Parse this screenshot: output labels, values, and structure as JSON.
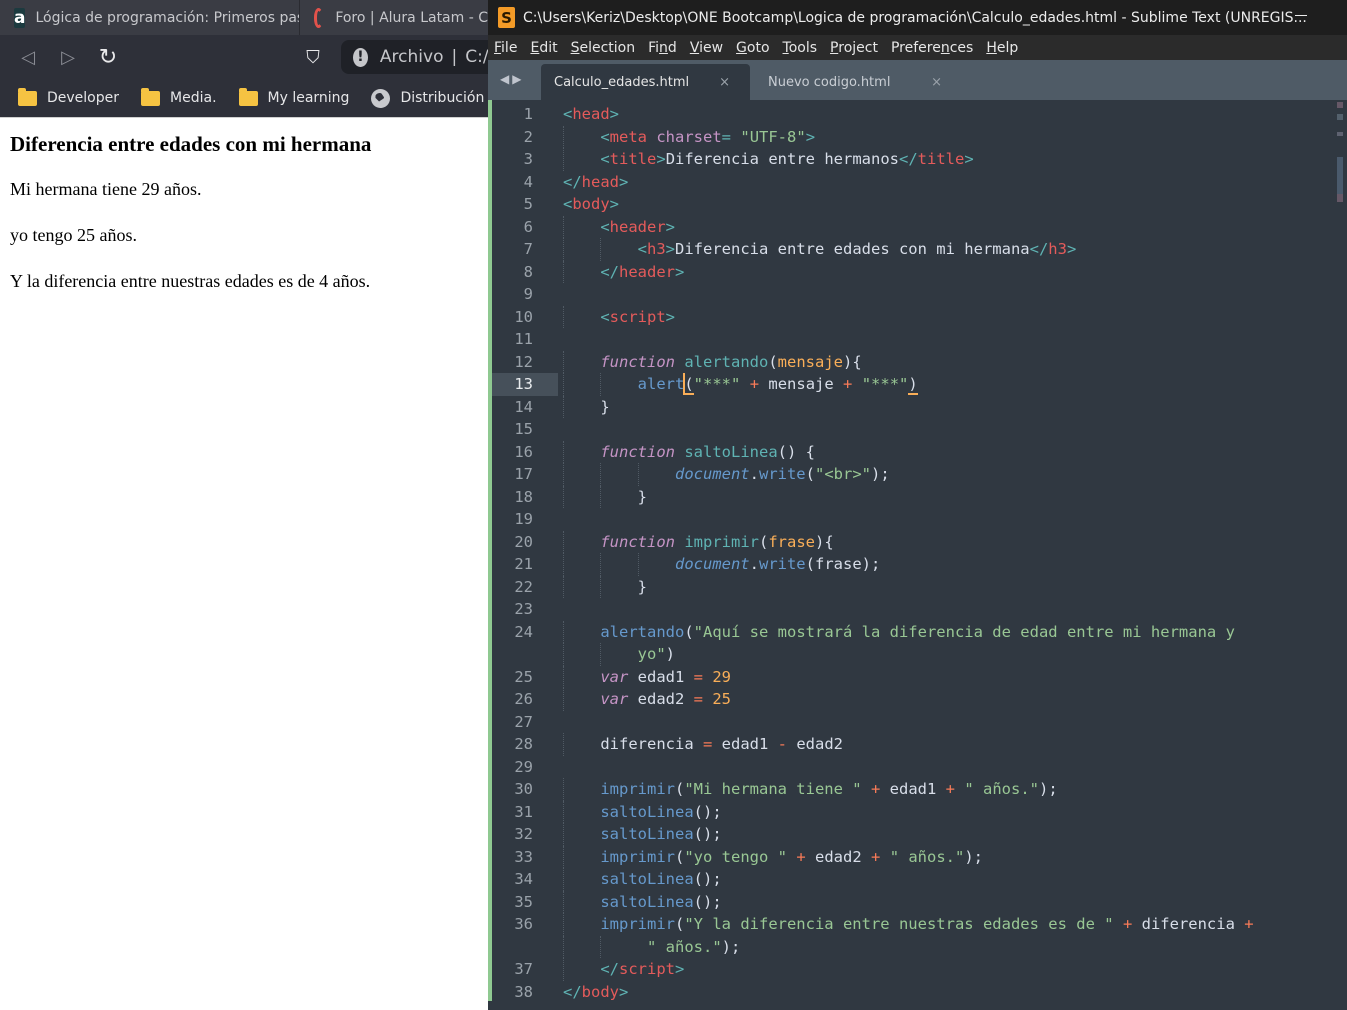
{
  "browser": {
    "tabs": [
      {
        "label": "Lógica de programación: Primeros pas",
        "icon": "alura-favicon"
      },
      {
        "label": "Foro | Alura Latam - C",
        "icon": "loading-spinner-icon"
      }
    ],
    "nav": {
      "back": "◁",
      "forward": "▷",
      "reload": "↻",
      "bookmark": "⛉"
    },
    "omnibox": {
      "info": "!",
      "scheme_label": "Archivo",
      "separator": "|",
      "url": "C:/U"
    },
    "bookmarks": [
      {
        "label": "Developer",
        "icon": "folder-icon"
      },
      {
        "label": "Media.",
        "icon": "folder-icon"
      },
      {
        "label": "My learning",
        "icon": "folder-icon"
      },
      {
        "label": "Distribución se",
        "icon": "globe-icon"
      }
    ],
    "page": {
      "heading": "Diferencia entre edades con mi hermana",
      "paragraphs": [
        "Mi hermana tiene 29 años.",
        "yo tengo 25 años.",
        "Y la diferencia entre nuestras edades es de 4 años."
      ]
    }
  },
  "sublime": {
    "logo": "S",
    "title": "C:\\Users\\Keriz\\Desktop\\ONE Bootcamp\\Logica de programación\\Calculo_edades.html - Sublime Text (UNREGIS...",
    "menu": [
      {
        "accel": "F",
        "rest": "ile"
      },
      {
        "accel": "E",
        "rest": "dit"
      },
      {
        "accel": "S",
        "rest": "election"
      },
      {
        "pre": "Fi",
        "accel": "n",
        "rest": "d"
      },
      {
        "accel": "V",
        "rest": "iew"
      },
      {
        "accel": "G",
        "rest": "oto"
      },
      {
        "accel": "T",
        "rest": "ools"
      },
      {
        "accel": "P",
        "rest": "roject"
      },
      {
        "pre": "Prefere",
        "accel": "n",
        "rest": "ces"
      },
      {
        "accel": "H",
        "rest": "elp"
      }
    ],
    "tab_arrows": "◀▶",
    "tabs": [
      {
        "label": "Calculo_edades.html",
        "active": true,
        "close": "×"
      },
      {
        "label": "Nuevo codigo.html",
        "active": false,
        "close": "×"
      }
    ],
    "current_line": 13,
    "lines": [
      {
        "n": "1",
        "indent": 0,
        "t": [
          [
            "punc",
            "<"
          ],
          [
            "tag",
            "head"
          ],
          [
            "punc",
            ">"
          ]
        ]
      },
      {
        "n": "2",
        "indent": 1,
        "t": [
          [
            "punc",
            "<"
          ],
          [
            "tag",
            "meta"
          ],
          [
            "plain",
            " "
          ],
          [
            "attr",
            "charset"
          ],
          [
            "punc",
            "="
          ],
          [
            "plain",
            " "
          ],
          [
            "str",
            "\"UTF-8\""
          ],
          [
            "punc",
            ">"
          ]
        ]
      },
      {
        "n": "3",
        "indent": 1,
        "t": [
          [
            "punc",
            "<"
          ],
          [
            "tag",
            "title"
          ],
          [
            "punc",
            ">"
          ],
          [
            "plain",
            "Diferencia entre hermanos"
          ],
          [
            "punc",
            "</"
          ],
          [
            "tag",
            "title"
          ],
          [
            "punc",
            ">"
          ]
        ]
      },
      {
        "n": "4",
        "indent": 0,
        "t": [
          [
            "punc",
            "</"
          ],
          [
            "tag",
            "head"
          ],
          [
            "punc",
            ">"
          ]
        ]
      },
      {
        "n": "5",
        "indent": 0,
        "t": [
          [
            "punc",
            "<"
          ],
          [
            "tag",
            "body"
          ],
          [
            "punc",
            ">"
          ]
        ]
      },
      {
        "n": "6",
        "indent": 1,
        "t": [
          [
            "punc",
            "<"
          ],
          [
            "tag",
            "header"
          ],
          [
            "punc",
            ">"
          ]
        ]
      },
      {
        "n": "7",
        "indent": 2,
        "t": [
          [
            "punc",
            "<"
          ],
          [
            "tag",
            "h3"
          ],
          [
            "punc",
            ">"
          ],
          [
            "plain",
            "Diferencia entre edades con mi hermana"
          ],
          [
            "punc",
            "</"
          ],
          [
            "tag",
            "h3"
          ],
          [
            "punc",
            ">"
          ]
        ]
      },
      {
        "n": "8",
        "indent": 1,
        "t": [
          [
            "punc",
            "</"
          ],
          [
            "tag",
            "header"
          ],
          [
            "punc",
            ">"
          ]
        ]
      },
      {
        "n": "9",
        "indent": 0,
        "t": []
      },
      {
        "n": "10",
        "indent": 1,
        "t": [
          [
            "punc",
            "<"
          ],
          [
            "tag",
            "script"
          ],
          [
            "punc",
            ">"
          ]
        ]
      },
      {
        "n": "11",
        "indent": 0,
        "t": []
      },
      {
        "n": "12",
        "indent": 1,
        "t": [
          [
            "kw",
            "function"
          ],
          [
            "plain",
            " "
          ],
          [
            "fn",
            "alertando"
          ],
          [
            "plain",
            "("
          ],
          [
            "param",
            "mensaje"
          ],
          [
            "plain",
            "){"
          ]
        ]
      },
      {
        "n": "13",
        "indent": 2,
        "t": [
          [
            "builtin",
            "alert"
          ],
          [
            "caret",
            ""
          ],
          [
            "under",
            "("
          ],
          [
            "str",
            "\"***\""
          ],
          [
            "plain",
            " "
          ],
          [
            "op",
            "+"
          ],
          [
            "plain",
            " mensaje "
          ],
          [
            "op",
            "+"
          ],
          [
            "plain",
            " "
          ],
          [
            "str",
            "\"***\""
          ],
          [
            "under",
            ")"
          ]
        ]
      },
      {
        "n": "14",
        "indent": 1,
        "t": [
          [
            "plain",
            "}"
          ]
        ]
      },
      {
        "n": "15",
        "indent": 0,
        "t": []
      },
      {
        "n": "16",
        "indent": 1,
        "t": [
          [
            "kw",
            "function"
          ],
          [
            "plain",
            " "
          ],
          [
            "fn",
            "saltoLinea"
          ],
          [
            "plain",
            "() {"
          ]
        ]
      },
      {
        "n": "17",
        "indent": 3,
        "t": [
          [
            "obj",
            "document"
          ],
          [
            "plain",
            "."
          ],
          [
            "builtin",
            "write"
          ],
          [
            "plain",
            "("
          ],
          [
            "str",
            "\"<br>\""
          ],
          [
            "plain",
            ");"
          ]
        ]
      },
      {
        "n": "18",
        "indent": 2,
        "t": [
          [
            "plain",
            "}"
          ]
        ]
      },
      {
        "n": "19",
        "indent": 0,
        "t": []
      },
      {
        "n": "20",
        "indent": 1,
        "t": [
          [
            "kw",
            "function"
          ],
          [
            "plain",
            " "
          ],
          [
            "fn",
            "imprimir"
          ],
          [
            "plain",
            "("
          ],
          [
            "param",
            "frase"
          ],
          [
            "plain",
            "){"
          ]
        ]
      },
      {
        "n": "21",
        "indent": 3,
        "t": [
          [
            "obj",
            "document"
          ],
          [
            "plain",
            "."
          ],
          [
            "builtin",
            "write"
          ],
          [
            "plain",
            "(frase);"
          ]
        ]
      },
      {
        "n": "22",
        "indent": 2,
        "t": [
          [
            "plain",
            "}"
          ]
        ]
      },
      {
        "n": "23",
        "indent": 0,
        "t": []
      },
      {
        "n": "24",
        "indent": 1,
        "t": [
          [
            "call",
            "alertando"
          ],
          [
            "plain",
            "("
          ],
          [
            "str",
            "\"Aquí se mostrará la diferencia de edad entre mi hermana y"
          ]
        ]
      },
      {
        "n": "",
        "indent": 2,
        "t": [
          [
            "str",
            "yo\""
          ],
          [
            "plain",
            ")"
          ]
        ]
      },
      {
        "n": "25",
        "indent": 1,
        "t": [
          [
            "kw",
            "var"
          ],
          [
            "plain",
            " edad1 "
          ],
          [
            "op",
            "="
          ],
          [
            "plain",
            " "
          ],
          [
            "num",
            "29"
          ]
        ]
      },
      {
        "n": "26",
        "indent": 1,
        "t": [
          [
            "kw",
            "var"
          ],
          [
            "plain",
            " edad2 "
          ],
          [
            "op",
            "="
          ],
          [
            "plain",
            " "
          ],
          [
            "num",
            "25"
          ]
        ]
      },
      {
        "n": "27",
        "indent": 0,
        "t": []
      },
      {
        "n": "28",
        "indent": 1,
        "t": [
          [
            "plain",
            "diferencia "
          ],
          [
            "op",
            "="
          ],
          [
            "plain",
            " edad1 "
          ],
          [
            "op",
            "-"
          ],
          [
            "plain",
            " edad2"
          ]
        ]
      },
      {
        "n": "29",
        "indent": 0,
        "t": []
      },
      {
        "n": "30",
        "indent": 1,
        "t": [
          [
            "call",
            "imprimir"
          ],
          [
            "plain",
            "("
          ],
          [
            "str",
            "\"Mi hermana tiene \""
          ],
          [
            "plain",
            " "
          ],
          [
            "op",
            "+"
          ],
          [
            "plain",
            " edad1 "
          ],
          [
            "op",
            "+"
          ],
          [
            "plain",
            " "
          ],
          [
            "str",
            "\" años.\""
          ],
          [
            "plain",
            ");"
          ]
        ]
      },
      {
        "n": "31",
        "indent": 1,
        "t": [
          [
            "call",
            "saltoLinea"
          ],
          [
            "plain",
            "();"
          ]
        ]
      },
      {
        "n": "32",
        "indent": 1,
        "t": [
          [
            "call",
            "saltoLinea"
          ],
          [
            "plain",
            "();"
          ]
        ]
      },
      {
        "n": "33",
        "indent": 1,
        "t": [
          [
            "call",
            "imprimir"
          ],
          [
            "plain",
            "("
          ],
          [
            "str",
            "\"yo tengo \""
          ],
          [
            "plain",
            " "
          ],
          [
            "op",
            "+"
          ],
          [
            "plain",
            " edad2 "
          ],
          [
            "op",
            "+"
          ],
          [
            "plain",
            " "
          ],
          [
            "str",
            "\" años.\""
          ],
          [
            "plain",
            ");"
          ]
        ]
      },
      {
        "n": "34",
        "indent": 1,
        "t": [
          [
            "call",
            "saltoLinea"
          ],
          [
            "plain",
            "();"
          ]
        ]
      },
      {
        "n": "35",
        "indent": 1,
        "t": [
          [
            "call",
            "saltoLinea"
          ],
          [
            "plain",
            "();"
          ]
        ]
      },
      {
        "n": "36",
        "indent": 1,
        "t": [
          [
            "call",
            "imprimir"
          ],
          [
            "plain",
            "("
          ],
          [
            "str",
            "\"Y la diferencia entre nuestras edades es de \""
          ],
          [
            "plain",
            " "
          ],
          [
            "op",
            "+"
          ],
          [
            "plain",
            " diferencia "
          ],
          [
            "op",
            "+"
          ]
        ]
      },
      {
        "n": "",
        "indent": 2,
        "wrapextra": true,
        "t": [
          [
            "str",
            "\" años.\""
          ],
          [
            "plain",
            ");"
          ]
        ]
      },
      {
        "n": "37",
        "indent": 1,
        "t": [
          [
            "punc",
            "</"
          ],
          [
            "tag",
            "script"
          ],
          [
            "punc",
            ">"
          ]
        ]
      },
      {
        "n": "38",
        "indent": 0,
        "t": [
          [
            "punc",
            "</"
          ],
          [
            "tag",
            "body"
          ],
          [
            "punc",
            ">"
          ]
        ]
      }
    ]
  }
}
